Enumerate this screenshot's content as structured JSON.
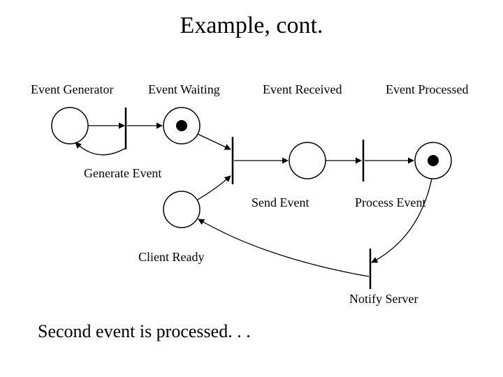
{
  "title": "Example, cont.",
  "labels": {
    "event_generator": "Event Generator",
    "event_waiting": "Event Waiting",
    "event_received": "Event Received",
    "event_processed": "Event Processed",
    "generate_event": "Generate Event",
    "send_event": "Send Event",
    "process_event": "Process Event",
    "client_ready": "Client Ready",
    "notify_server": "Notify Server"
  },
  "footer": "Second event is processed. . .",
  "chart_data": {
    "type": "diagram",
    "notation": "Petri net",
    "places": [
      {
        "id": "event_generator",
        "label": "Event Generator",
        "tokens": 0
      },
      {
        "id": "event_waiting",
        "label": "Event Waiting",
        "tokens": 1
      },
      {
        "id": "event_received",
        "label": "Event Received",
        "tokens": 0
      },
      {
        "id": "event_processed",
        "label": "Event Processed",
        "tokens": 1
      },
      {
        "id": "client_ready",
        "label": "Client Ready",
        "tokens": 0
      }
    ],
    "transitions": [
      {
        "id": "generate_event",
        "label": "Generate Event"
      },
      {
        "id": "send_event",
        "label": "Send Event"
      },
      {
        "id": "process_event",
        "label": "Process Event"
      },
      {
        "id": "notify_server",
        "label": "Notify Server"
      }
    ],
    "arcs": [
      {
        "from": "event_generator",
        "to": "generate_event"
      },
      {
        "from": "generate_event",
        "to": "event_waiting"
      },
      {
        "from": "generate_event",
        "to": "event_generator"
      },
      {
        "from": "event_waiting",
        "to": "send_event"
      },
      {
        "from": "client_ready",
        "to": "send_event"
      },
      {
        "from": "send_event",
        "to": "event_received"
      },
      {
        "from": "event_received",
        "to": "process_event"
      },
      {
        "from": "process_event",
        "to": "event_processed"
      },
      {
        "from": "event_processed",
        "to": "notify_server"
      },
      {
        "from": "notify_server",
        "to": "client_ready"
      }
    ],
    "caption": "Second event is processed. . ."
  }
}
